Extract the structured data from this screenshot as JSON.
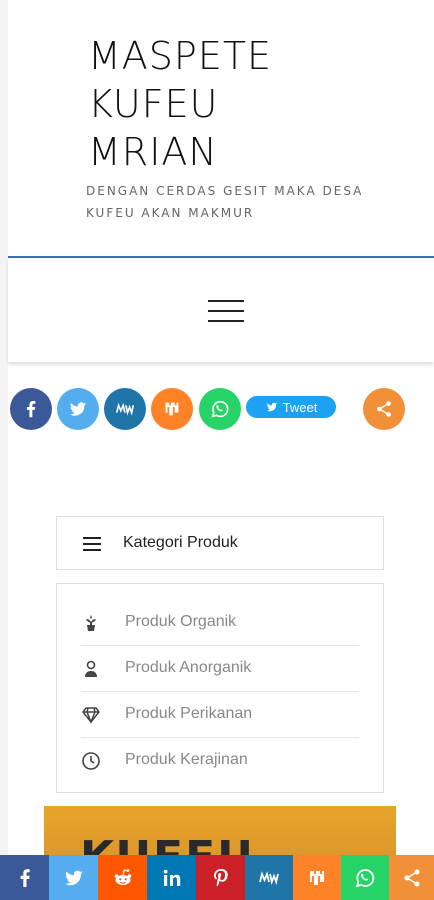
{
  "site": {
    "title_lines": [
      "MASPETE",
      "KUFEU",
      "MRIAN"
    ],
    "tagline": "DENGAN CERDAS GESIT MAKA DESA KUFEU AKAN MAKMUR"
  },
  "colors": {
    "header_line": "#3a6fb7",
    "facebook": "#3b5998",
    "twitter": "#55acee",
    "mewe": "#1f75a8",
    "mix": "#ff8226",
    "whatsapp": "#25d366",
    "reddit": "#ff5700",
    "linkedin": "#0077b5",
    "pinterest": "#cb2027",
    "share": "#f2903a"
  },
  "share_row": {
    "icons": [
      "facebook-icon",
      "twitter-icon",
      "mewe-icon",
      "mix-icon",
      "whatsapp-icon",
      "share-icon"
    ],
    "tweet_label": "Tweet"
  },
  "categories": {
    "heading": "Kategori Produk",
    "items": [
      {
        "label": "Produk Organik",
        "icon": "plant-icon"
      },
      {
        "label": "Produk Anorganik",
        "icon": "person-icon"
      },
      {
        "label": "Produk Perikanan",
        "icon": "diamond-icon"
      },
      {
        "label": "Produk Kerajinan",
        "icon": "clock-icon"
      }
    ]
  },
  "banner": {
    "text": "KUFEU"
  },
  "bottom_bar": {
    "icons": [
      "facebook-icon",
      "twitter-icon",
      "reddit-icon",
      "linkedin-icon",
      "pinterest-icon",
      "mewe-icon",
      "mix-icon",
      "whatsapp-icon",
      "share-icon"
    ]
  }
}
